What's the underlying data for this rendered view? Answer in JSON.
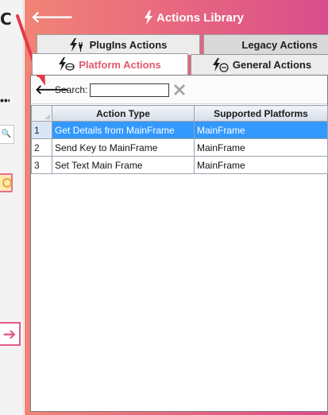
{
  "left_strip": {
    "refresh_glyph": "C",
    "dots_glyph": "•••",
    "search_glyph": "🔍",
    "arrow_glyph": "➔"
  },
  "header": {
    "title": "Actions Library",
    "back_glyph": "🡐",
    "background_gradient": [
      "#f08476",
      "#d94d8c"
    ],
    "title_color": "#ffffff"
  },
  "tabs": {
    "row1": [
      {
        "label": "PlugIns Actions",
        "icon": "plugin-lightning-icon"
      },
      {
        "label": "Legacy Actions",
        "icon": null
      }
    ],
    "row2": [
      {
        "label": "Platform Actions",
        "icon": "platform-lightning-icon",
        "selected": true,
        "color": "#e05a6e"
      },
      {
        "label": "General Actions",
        "icon": "general-lightning-icon"
      }
    ]
  },
  "toolbar": {
    "back_glyph": "🡐",
    "search_label": "Search:",
    "search_value": "",
    "clear_icon": "clear-x-icon"
  },
  "grid": {
    "columns": [
      "Action Type",
      "Supported Platforms"
    ],
    "rows": [
      {
        "n": "1",
        "action_type": "Get Details from MainFrame",
        "platform": "MainFrame",
        "selected": true
      },
      {
        "n": "2",
        "action_type": "Send Key to MainFrame",
        "platform": "MainFrame",
        "selected": false
      },
      {
        "n": "3",
        "action_type": "Set Text Main Frame",
        "platform": "MainFrame",
        "selected": false
      }
    ],
    "selection_color": "#3399ff"
  },
  "annotation_color": "#e63946"
}
